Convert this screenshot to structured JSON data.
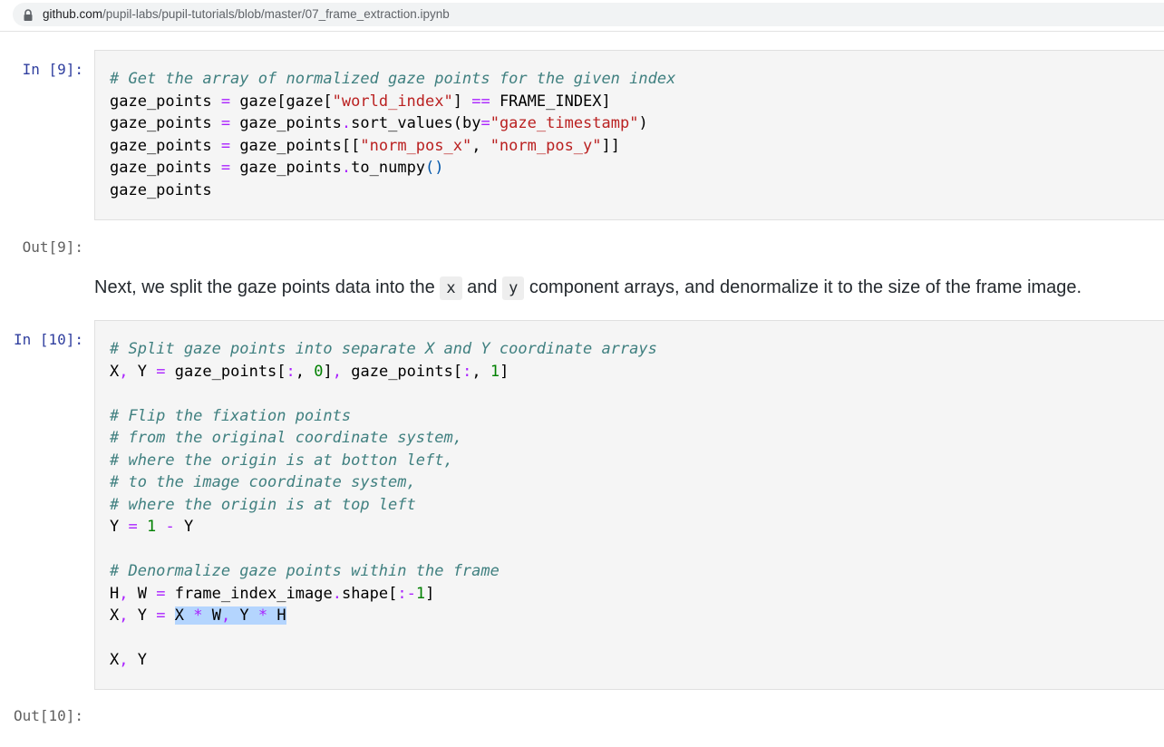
{
  "browser": {
    "url_host": "github.com",
    "url_path": "/pupil-labs/pupil-tutorials/blob/master/07_frame_extraction.ipynb"
  },
  "cells": {
    "in9_prompt": "In [9]:",
    "out9_prompt": "Out[9]:",
    "in10_prompt": "In [10]:",
    "out10_prompt": "Out[10]:"
  },
  "markdown": {
    "part1": "Next, we split the gaze points data into the",
    "code_x": "x",
    "part2": "and",
    "code_y": "y",
    "part3": "component arrays, and denormalize it to the size of the frame image."
  },
  "cell9_code": [
    "# Get the array of normalized gaze points for the given index",
    "gaze_points = gaze[gaze[\"world_index\"] == FRAME_INDEX]",
    "gaze_points = gaze_points.sort_values(by=\"gaze_timestamp\")",
    "gaze_points = gaze_points[[\"norm_pos_x\", \"norm_pos_y\"]]",
    "gaze_points = gaze_points.to_numpy()",
    "gaze_points"
  ],
  "cell10_code": [
    "# Split gaze points into separate X and Y coordinate arrays",
    "X, Y = gaze_points[:, 0], gaze_points[:, 1]",
    "",
    "# Flip the fixation points",
    "# from the original coordinate system,",
    "# where the origin is at botton left,",
    "# to the image coordinate system,",
    "# where the origin is at top left",
    "Y = 1 - Y",
    "",
    "# Denormalize gaze points within the frame",
    "H, W = frame_index_image.shape[:-1]",
    "X, Y = X * W, Y * H",
    "",
    "X, Y"
  ],
  "selection": {
    "text": "X * W, Y * H",
    "highlight_color": "#b4d5fe"
  }
}
